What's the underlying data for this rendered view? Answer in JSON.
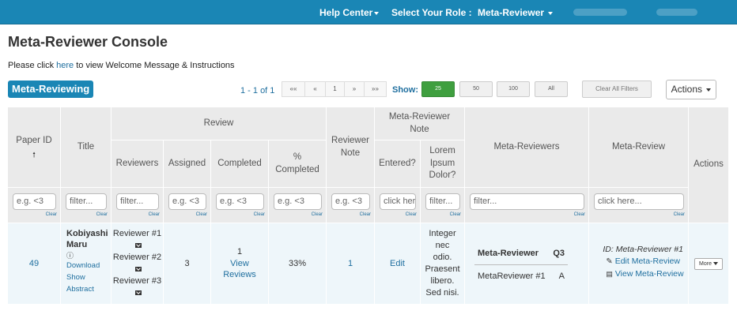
{
  "topbar": {
    "help_center": "Help Center",
    "select_role_label": "Select Your Role :",
    "role": "Meta-Reviewer",
    "colors": {
      "bar": "#1a86b5"
    }
  },
  "page": {
    "title": "Meta-Reviewer Console",
    "intro_pre": "Please click ",
    "intro_link": "here",
    "intro_post": " to view Welcome Message & Instructions"
  },
  "toolbar": {
    "section_title": "Meta-Reviewing",
    "pager_info": "1 - 1 of 1",
    "pager": [
      "««",
      "«",
      "1",
      "»",
      "»»"
    ],
    "show_label": "Show:",
    "show_options": [
      "25",
      "50",
      "100",
      "All"
    ],
    "show_selected": "25",
    "clear_filters": "Clear All Filters",
    "actions": "Actions"
  },
  "table": {
    "headers": {
      "paper_id": "Paper ID",
      "title": "Title",
      "review_group": "Review",
      "reviewers": "Reviewers",
      "assigned": "Assigned",
      "completed": "Completed",
      "pct_completed": "% Completed",
      "reviewer_note": "Reviewer Note",
      "meta_note_group": "Meta-Reviewer Note",
      "entered": "Entered?",
      "lorem": "Lorem Ipsum Dolor?",
      "meta_reviewers": "Meta-Reviewers",
      "meta_review": "Meta-Review",
      "actions": "Actions"
    },
    "filters": {
      "paper_id": "e.g. <3",
      "title": "filter...",
      "reviewers": "filter...",
      "assigned": "e.g. <3",
      "completed": "e.g. <3",
      "pct_completed": "e.g. <3",
      "reviewer_note": "e.g. <3",
      "entered": "click here",
      "lorem": "filter...",
      "meta_reviewers": "filter...",
      "meta_review": "click here...",
      "clear_label": "Clear"
    },
    "row": {
      "paper_id": "49",
      "title": "Kobiyashi Maru",
      "download": "Download",
      "show_abstract": "Show Abstract",
      "reviewers": [
        "Reviewer #1",
        "Reviewer #2",
        "Reviewer #3"
      ],
      "assigned": "3",
      "completed_count": "1",
      "view_reviews": "View Reviews",
      "pct_completed": "33%",
      "reviewer_note": "1",
      "entered": "Edit",
      "lorem_text": "Integer nec odio. Praesent libero. Sed nisi.",
      "meta_table": {
        "col1": "Meta-Reviewer",
        "col2": "Q3",
        "name": "MetaReviewer #1",
        "value": "A"
      },
      "meta_review_id": "ID: Meta-Reviewer #1",
      "edit_meta_review": "Edit Meta-Review",
      "view_meta_review": "View Meta-Review",
      "more": "More"
    }
  }
}
